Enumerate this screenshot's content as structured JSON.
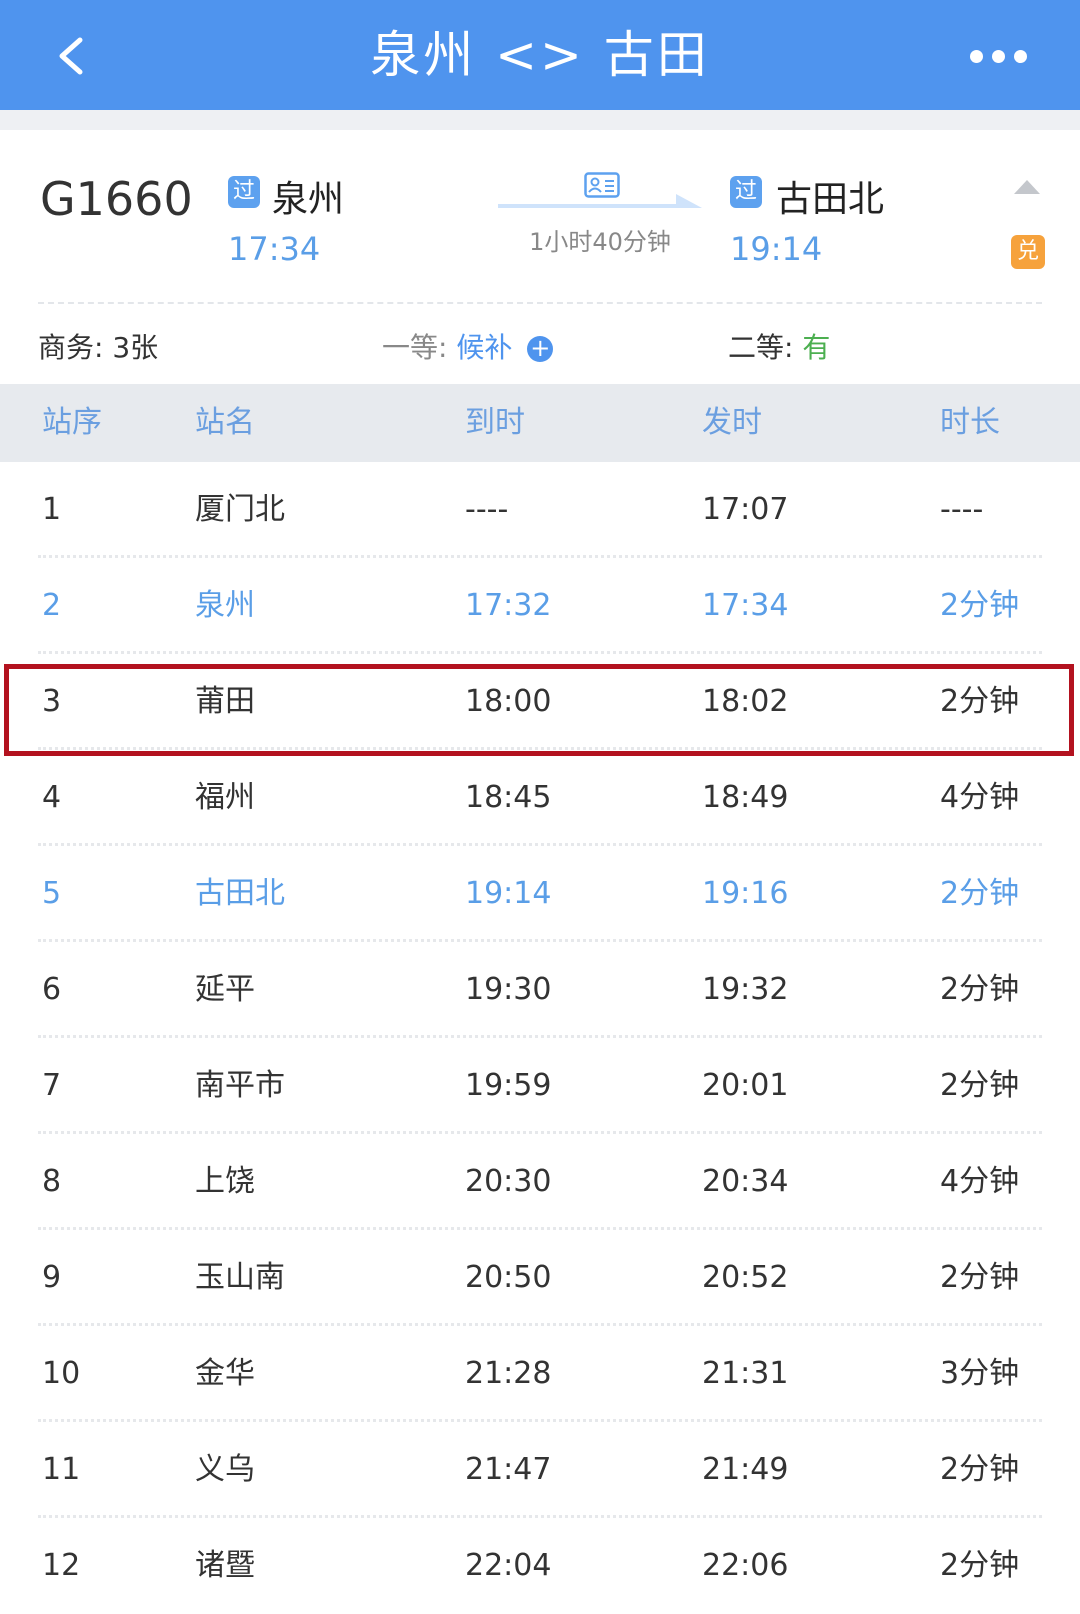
{
  "header": {
    "title": "泉州 <> 古田",
    "back_icon": "chevron-left-icon",
    "more_icon": "more-dots-icon"
  },
  "train": {
    "number": "G1660",
    "from": {
      "badge": "过",
      "station": "泉州",
      "time": "17:34"
    },
    "duration": "1小时40分钟",
    "to": {
      "badge": "过",
      "station": "古田北",
      "time": "19:14"
    },
    "exchange_badge": "兑"
  },
  "seats": {
    "business": "商务: 3张",
    "first_label": "一等:",
    "first_status": "候补",
    "first_plus": "+",
    "second_label": "二等:",
    "second_status": "有"
  },
  "table": {
    "headers": [
      "站序",
      "站名",
      "到时",
      "发时",
      "时长"
    ],
    "rows": [
      {
        "seq": "1",
        "name": "厦门北",
        "arrive": "----",
        "depart": "17:07",
        "stay": "----",
        "highlight": false
      },
      {
        "seq": "2",
        "name": "泉州",
        "arrive": "17:32",
        "depart": "17:34",
        "stay": "2分钟",
        "highlight": true
      },
      {
        "seq": "3",
        "name": "莆田",
        "arrive": "18:00",
        "depart": "18:02",
        "stay": "2分钟",
        "highlight": false
      },
      {
        "seq": "4",
        "name": "福州",
        "arrive": "18:45",
        "depart": "18:49",
        "stay": "4分钟",
        "highlight": false
      },
      {
        "seq": "5",
        "name": "古田北",
        "arrive": "19:14",
        "depart": "19:16",
        "stay": "2分钟",
        "highlight": true
      },
      {
        "seq": "6",
        "name": "延平",
        "arrive": "19:30",
        "depart": "19:32",
        "stay": "2分钟",
        "highlight": false
      },
      {
        "seq": "7",
        "name": "南平市",
        "arrive": "19:59",
        "depart": "20:01",
        "stay": "2分钟",
        "highlight": false
      },
      {
        "seq": "8",
        "name": "上饶",
        "arrive": "20:30",
        "depart": "20:34",
        "stay": "4分钟",
        "highlight": false
      },
      {
        "seq": "9",
        "name": "玉山南",
        "arrive": "20:50",
        "depart": "20:52",
        "stay": "2分钟",
        "highlight": false
      },
      {
        "seq": "10",
        "name": "金华",
        "arrive": "21:28",
        "depart": "21:31",
        "stay": "3分钟",
        "highlight": false
      },
      {
        "seq": "11",
        "name": "义乌",
        "arrive": "21:47",
        "depart": "21:49",
        "stay": "2分钟",
        "highlight": false
      },
      {
        "seq": "12",
        "name": "诸暨",
        "arrive": "22:04",
        "depart": "22:06",
        "stay": "2分钟",
        "highlight": false
      }
    ]
  },
  "colors": {
    "header_bg": "#4f94ee",
    "accent_blue": "#5a9ee7",
    "available_green": "#4caf50",
    "exchange_orange": "#f6a23c",
    "annotation_red": "#b3121f"
  }
}
